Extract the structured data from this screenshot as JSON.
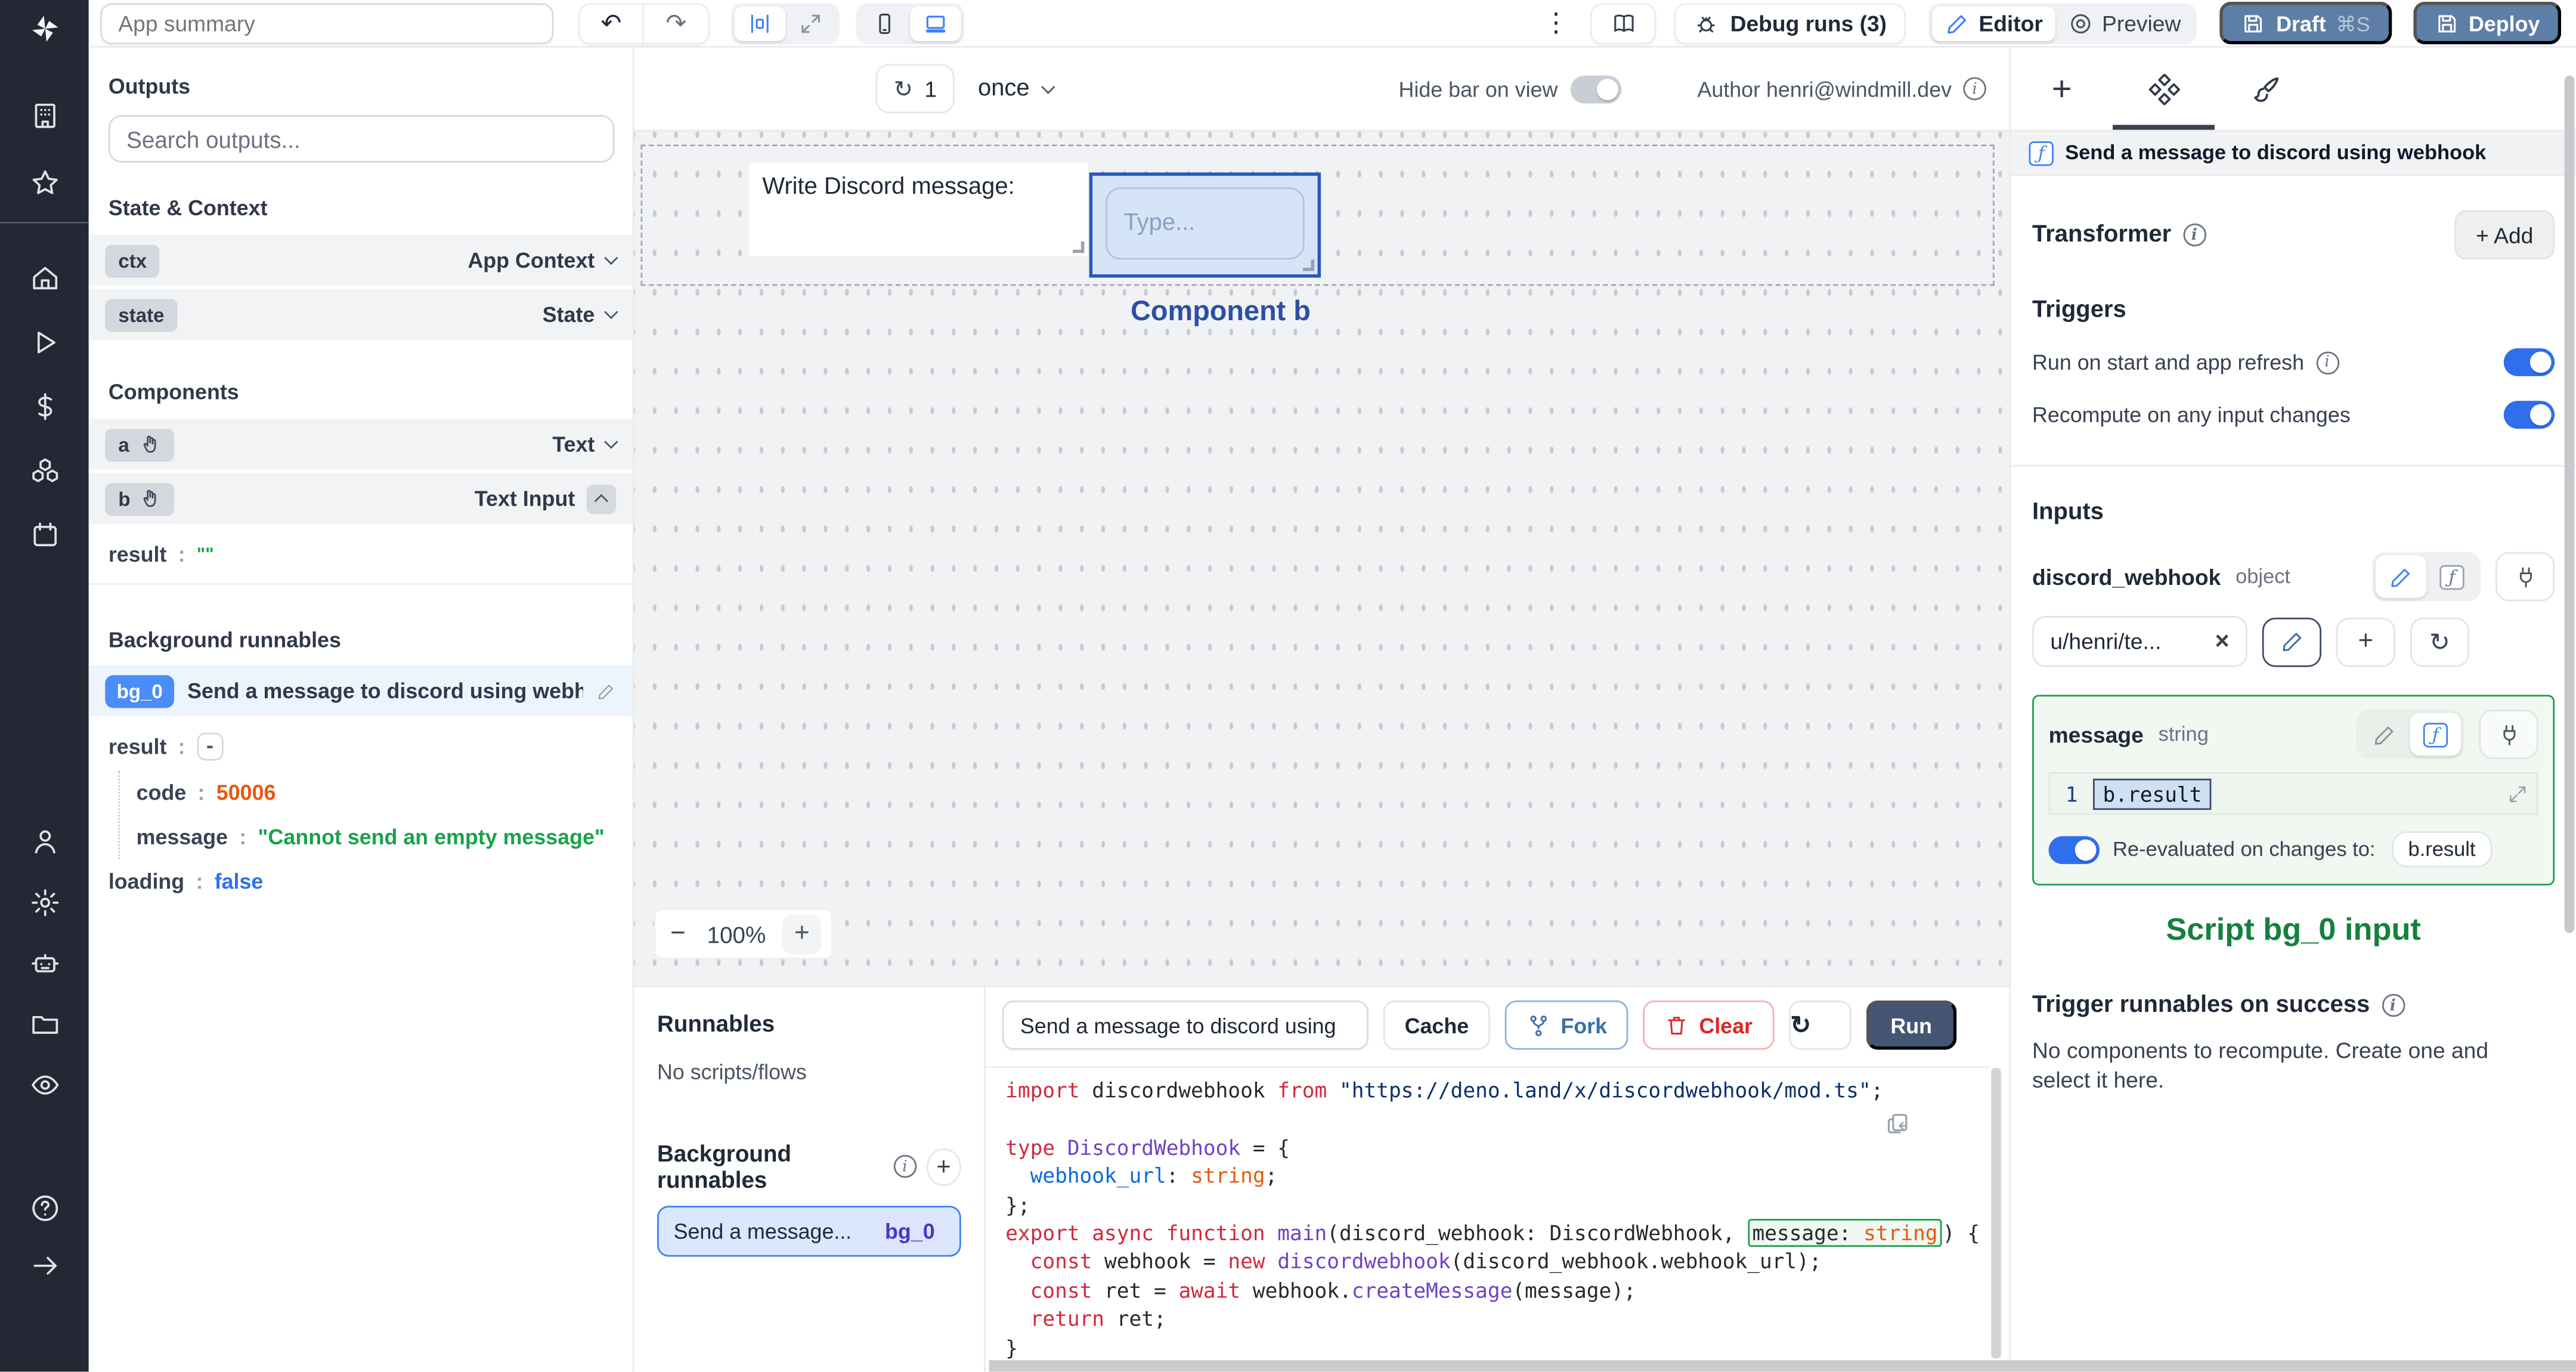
{
  "glyphs": {
    "plus": "+",
    "minus": "−",
    "undo": "↶",
    "redo": "↷",
    "kebab": "⋮",
    "refresh": "↻",
    "close": "×",
    "fn": "ƒ",
    "info": "i",
    "colon": ":",
    "collapse": "-"
  },
  "topbar": {
    "app_summary_placeholder": "App summary",
    "debug_runs_label": "Debug runs (3)",
    "editor_label": "Editor",
    "preview_label": "Preview",
    "draft_label": "Draft",
    "draft_shortcut": "⌘S",
    "deploy_label": "Deploy"
  },
  "outputs_panel": {
    "title": "Outputs",
    "search_placeholder": "Search outputs...",
    "state_context_title": "State & Context",
    "ctx_key": "ctx",
    "ctx_type": "App Context",
    "state_key": "state",
    "state_type": "State",
    "components_title": "Components",
    "comp_a_key": "a",
    "comp_a_type": "Text",
    "comp_b_key": "b",
    "comp_b_type": "Text Input",
    "b_result_key": "result",
    "b_result_value": "\"\"",
    "background_title": "Background runnables",
    "bg_badge": "bg_0",
    "bg_label": "Send a message to discord using webhook",
    "result_key": "result",
    "code_key": "code",
    "code_value": "50006",
    "message_key": "message",
    "message_value": "\"Cannot send an empty message\"",
    "loading_key": "loading",
    "loading_value": "false"
  },
  "canvas": {
    "refresh_count": "1",
    "schedule": "once",
    "hide_bar_label": "Hide bar on view",
    "author_label": "Author henri@windmill.dev",
    "text_component": "Write Discord message:",
    "input_placeholder": "Type...",
    "selected_component_label": "Component b",
    "zoom_out": "−",
    "zoom_level": "100%",
    "zoom_in": "+"
  },
  "runnables_panel": {
    "title": "Runnables",
    "empty_label": "No scripts/flows",
    "background_title": "Background runnables",
    "item_label": "Send a message...",
    "item_badge": "bg_0"
  },
  "code_panel": {
    "script_name": "Send a message to discord using",
    "cache_label": "Cache",
    "fork_label": "Fork",
    "clear_label": "Clear",
    "run_label": "Run",
    "lines": [
      [
        {
          "c": "kw",
          "t": "import "
        },
        {
          "c": "pl",
          "t": "discordwebhook "
        },
        {
          "c": "kw",
          "t": "from "
        },
        {
          "c": "str",
          "t": "\"https://deno.land/x/discordwebhook/mod.ts\""
        },
        {
          "c": "pl",
          "t": ";"
        }
      ],
      [],
      [
        {
          "c": "kw",
          "t": "type "
        },
        {
          "c": "id",
          "t": "DiscordWebhook"
        },
        {
          "c": "pl",
          "t": " = {"
        }
      ],
      [
        {
          "c": "pl",
          "t": "  "
        },
        {
          "c": "prop",
          "t": "webhook_url"
        },
        {
          "c": "pl",
          "t": ": "
        },
        {
          "c": "type",
          "t": "string"
        },
        {
          "c": "pl",
          "t": ";"
        }
      ],
      [
        {
          "c": "pl",
          "t": "};"
        }
      ],
      [
        {
          "c": "kw",
          "t": "export "
        },
        {
          "c": "kw",
          "t": "async "
        },
        {
          "c": "kw",
          "t": "function "
        },
        {
          "c": "id",
          "t": "main"
        },
        {
          "c": "pl",
          "t": "(discord_webhook: DiscordWebhook, "
        },
        {
          "c": "pl",
          "t": "message: ",
          "b": true
        },
        {
          "c": "type",
          "t": "string",
          "b": true
        },
        {
          "c": "pl",
          "t": ") {"
        }
      ],
      [
        {
          "c": "pl",
          "t": "  "
        },
        {
          "c": "kw",
          "t": "const "
        },
        {
          "c": "pl",
          "t": "webhook = "
        },
        {
          "c": "kw",
          "t": "new "
        },
        {
          "c": "id",
          "t": "discordwebhook"
        },
        {
          "c": "pl",
          "t": "(discord_webhook.webhook_url);"
        }
      ],
      [
        {
          "c": "pl",
          "t": "  "
        },
        {
          "c": "kw",
          "t": "const "
        },
        {
          "c": "pl",
          "t": "ret = "
        },
        {
          "c": "kw",
          "t": "await "
        },
        {
          "c": "pl",
          "t": "webhook."
        },
        {
          "c": "id",
          "t": "createMessage"
        },
        {
          "c": "pl",
          "t": "(message);"
        }
      ],
      [
        {
          "c": "pl",
          "t": "  "
        },
        {
          "c": "kw",
          "t": "return "
        },
        {
          "c": "pl",
          "t": "ret;"
        }
      ],
      [
        {
          "c": "pl",
          "t": "}"
        }
      ]
    ]
  },
  "right_panel": {
    "header_title": "Send a message to discord using webhook",
    "transformer_label": "Transformer",
    "add_label": "+ Add",
    "triggers_title": "Triggers",
    "trigger_run_on_start": "Run on start and app refresh",
    "trigger_recompute": "Recompute on any input changes",
    "inputs_title": "Inputs",
    "field1_name": "discord_webhook",
    "field1_type": "object",
    "field1_value": "u/henri/te...",
    "field2_name": "message",
    "field2_type": "string",
    "editor_line_number": "1",
    "editor_value": "b.result",
    "reeval_label": "Re-evaluated on changes to:",
    "reeval_chip": "b.result",
    "script_input_caption": "Script bg_0 input",
    "on_success_title": "Trigger runnables on success",
    "on_success_text": "No components to recompute. Create one and select it here."
  },
  "colors": {
    "accent_blue": "#2f6fed",
    "steel_button": "#5d7ea6",
    "run_button": "#445674",
    "bg0_badge": "#4a8cf8",
    "success_green": "#1a9e4b",
    "script_caption_green": "#15803d",
    "selected_component_blue": "#2d4fa2",
    "value_orange": "#e8590c",
    "value_green": "#18a34a",
    "value_blue": "#2f6fed"
  }
}
